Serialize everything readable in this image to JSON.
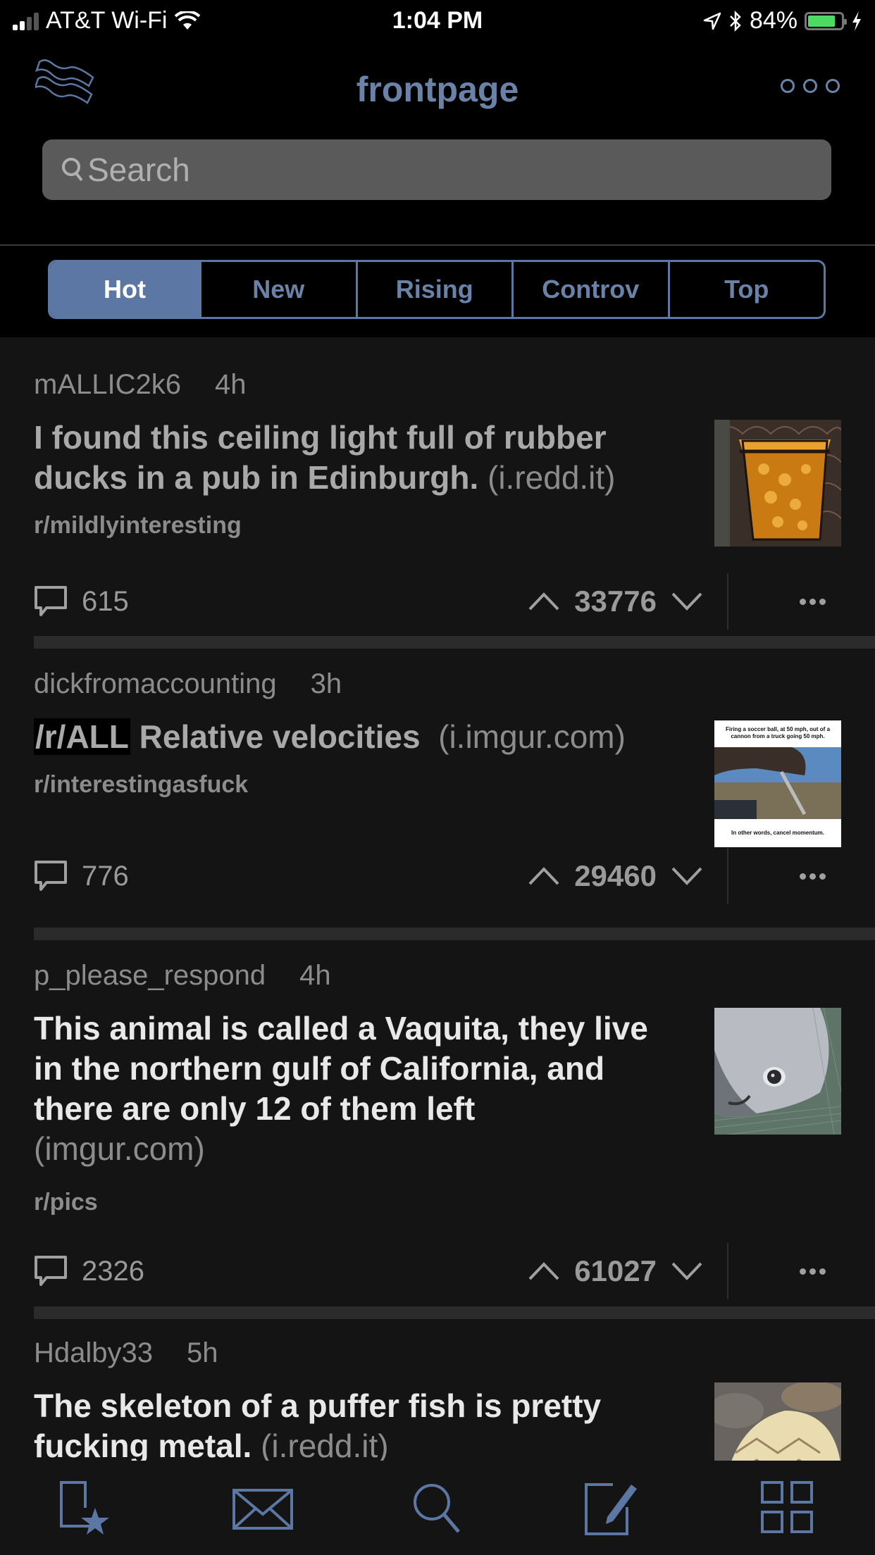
{
  "status_bar": {
    "carrier": "AT&T Wi-Fi",
    "time": "1:04 PM",
    "battery_percent": "84%",
    "battery_level": 0.84,
    "icons": [
      "signal-icon",
      "wifi-icon",
      "location-icon",
      "bluetooth-icon",
      "battery-icon",
      "charging-icon"
    ]
  },
  "header": {
    "title": "frontpage",
    "logo_icon": "bacon-logo-icon",
    "more_icon": "more-options-icon"
  },
  "search": {
    "placeholder": "Search",
    "value": ""
  },
  "sort_tabs": {
    "active": "Hot",
    "items": [
      {
        "label": "Hot"
      },
      {
        "label": "New"
      },
      {
        "label": "Rising"
      },
      {
        "label": "Controv"
      },
      {
        "label": "Top"
      }
    ]
  },
  "accent_color": "#5c77a3",
  "posts": [
    {
      "author": "mALLIC2k6",
      "age": "4h",
      "flair": "",
      "title": "I found this ceiling light full of rubber ducks in a pub in Edinburgh.",
      "domain": "(i.redd.it)",
      "subreddit": "r/mildlyinteresting",
      "comments": "615",
      "score": "33776",
      "thumbnail": "orange glowing lamp"
    },
    {
      "author": "dickfromaccounting",
      "age": "3h",
      "flair": "/r/ALL",
      "title": "Relative velocities",
      "domain": "(i.imgur.com)",
      "subreddit": "r/interestingasfuck",
      "comments": "776",
      "score": "29460",
      "thumbnail": "meme image",
      "thumb_caption_top": "Firing a soccer ball, at 50 mph, out of a cannon from a truck going 50 mph.",
      "thumb_caption_bottom": "In other words, cancel momentum."
    },
    {
      "author": "p_please_respond",
      "age": "4h",
      "flair": "",
      "title": "This animal is called a Vaquita, they live in the northern gulf of California, and there are only 12 of them left",
      "domain": "(imgur.com)",
      "subreddit": "r/pics",
      "comments": "2326",
      "score": "61027",
      "thumbnail": "vaquita porpoise"
    },
    {
      "author": "Hdalby33",
      "age": "5h",
      "flair": "",
      "title": "The skeleton of a puffer fish is pretty fucking metal.",
      "domain": "(i.redd.it)",
      "subreddit": "",
      "comments": "",
      "score": "",
      "thumbnail": "puffer fish skeleton"
    }
  ],
  "tab_bar": {
    "items": [
      {
        "name": "favorites",
        "icon": "favorites-icon"
      },
      {
        "name": "inbox",
        "icon": "mail-icon"
      },
      {
        "name": "search",
        "icon": "search-icon"
      },
      {
        "name": "compose",
        "icon": "compose-icon"
      },
      {
        "name": "more",
        "icon": "grid-icon"
      }
    ]
  }
}
